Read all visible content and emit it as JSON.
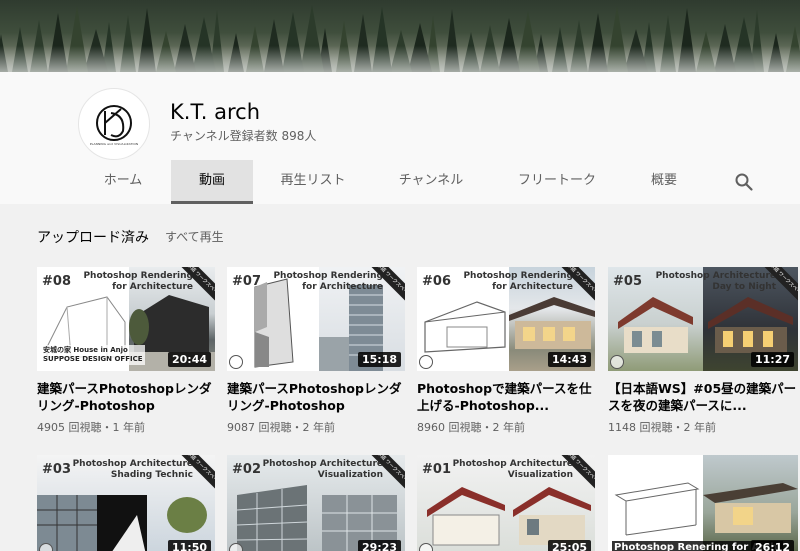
{
  "channel": {
    "name": "K.T. arch",
    "subscribers": "チャンネル登録者数 898人",
    "avatar_text": "PLANNING and VISUALIZATION"
  },
  "tabs": [
    {
      "label": "ホーム"
    },
    {
      "label": "動画"
    },
    {
      "label": "再生リスト"
    },
    {
      "label": "チャンネル"
    },
    {
      "label": "フリートーク"
    },
    {
      "label": "概要"
    }
  ],
  "section": {
    "title": "アップロード済み",
    "play_all": "すべて再生"
  },
  "videos": [
    {
      "ep": "#08",
      "thumb_title": "Photoshop Rendering\nfor Architecture",
      "duration": "20:44",
      "caption": "安城の家 House in Anjo\nSUPPOSE DESIGN OFFICE",
      "title": "建築パースPhotoshopレンダリング-Photoshop Renderin...",
      "meta": "4905 回視聴・1 年前",
      "ribbon": "日本語 ワークスペース"
    },
    {
      "ep": "#07",
      "thumb_title": "Photoshop Rendering\nfor Architecture",
      "duration": "15:18",
      "title": "建築パースPhotoshopレンダリング-Photoshop Renderin...",
      "meta": "9087 回視聴・2 年前",
      "ribbon": "日本語 ワークスペース"
    },
    {
      "ep": "#06",
      "thumb_title": "Photoshop Rendering\nfor Architecture",
      "duration": "14:43",
      "title": "Photoshopで建築パースを仕上げる-Photoshop...",
      "meta": "8960 回視聴・2 年前",
      "ribbon": "日本語 ワークスペース"
    },
    {
      "ep": "#05",
      "thumb_title": "Photoshop Architecture\nDay to Night",
      "duration": "11:27",
      "title": "【日本語WS】#05昼の建築パースを夜の建築パースに...",
      "meta": "1148 回視聴・2 年前",
      "ribbon": "日本語 ワークスペース"
    },
    {
      "ep": "#03",
      "thumb_title": "Photoshop Architecture\nShading Technic",
      "duration": "11:50",
      "ribbon": "日本語 ワークスペース"
    },
    {
      "ep": "#02",
      "thumb_title": "Photoshop Architecture\nVisualization",
      "duration": "29:23",
      "ribbon": "日本語 ワークスペース"
    },
    {
      "ep": "#01",
      "thumb_title": "Photoshop Architecture\nVisualization",
      "duration": "25:05",
      "ribbon": "日本語 ワークスペース"
    },
    {
      "ep": "",
      "thumb_title": "",
      "duration": "26:12",
      "caption": "Photoshop Renering for Archi",
      "ribbon": ""
    }
  ],
  "colors": {
    "accent": "#606060",
    "active_tab_bg": "#e2e2e2",
    "page_bg": "#f1f1f1"
  }
}
